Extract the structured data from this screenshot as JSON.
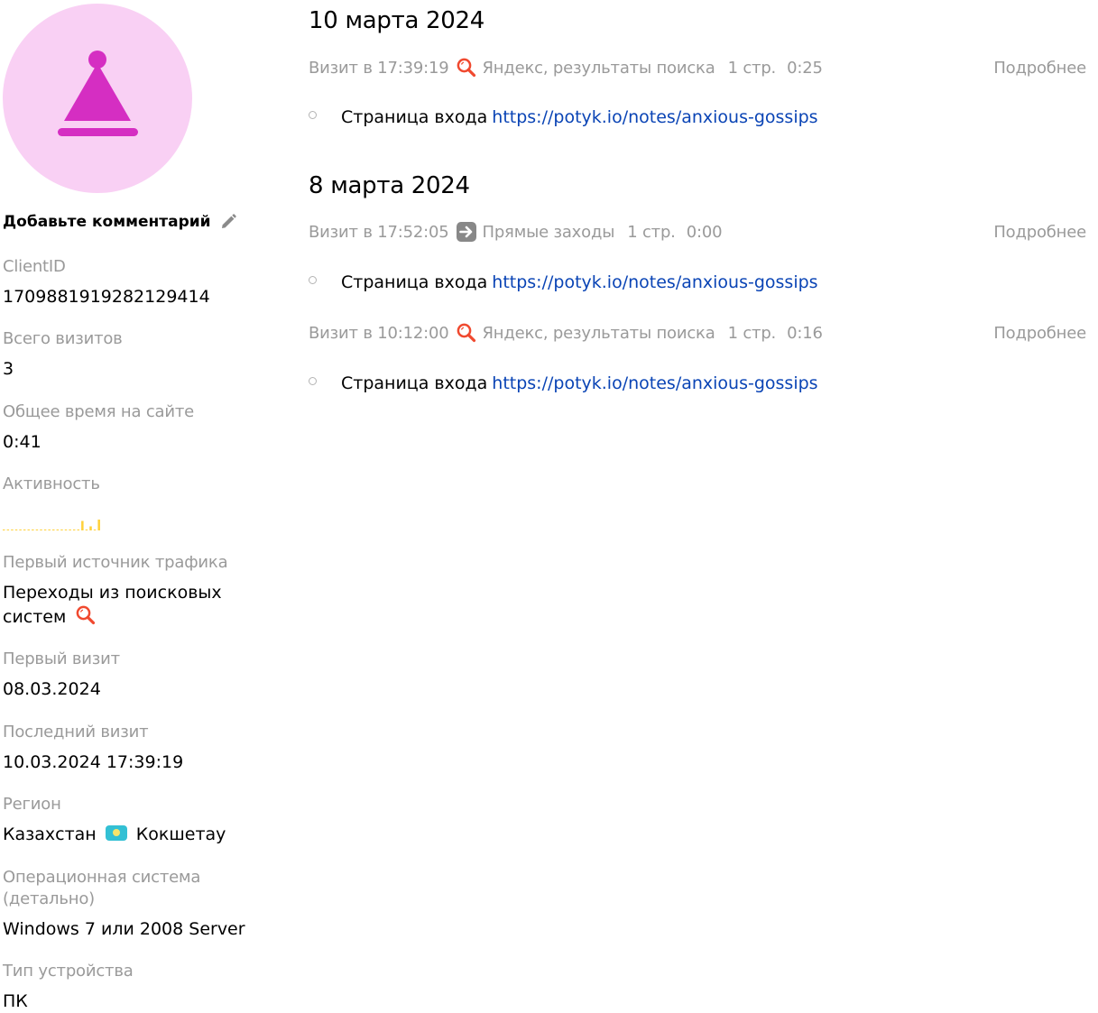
{
  "sidebar": {
    "comment_placeholder": "Добавьте комментарий",
    "fields": [
      {
        "label": "ClientID",
        "value": "1709881919282129414"
      },
      {
        "label": "Всего визитов",
        "value": "3"
      },
      {
        "label": "Общее время на сайте",
        "value": "0:41"
      },
      {
        "label": "Активность"
      },
      {
        "label": "Первый источник трафика",
        "value": "Переходы из поисковых",
        "value_line2": "систем"
      },
      {
        "label": "Первый визит",
        "value": "08.03.2024"
      },
      {
        "label": "Последний визит",
        "value": "10.03.2024 17:39:19"
      },
      {
        "label": "Регион",
        "country": "Казахстан",
        "city": "Кокшетау"
      },
      {
        "label": "Операционная система",
        "label_line2": "(детально)",
        "value": "Windows 7 или 2008 Server"
      },
      {
        "label": "Тип устройства",
        "value": "ПК"
      }
    ],
    "activity_levels": [
      0,
      0,
      0,
      0,
      0,
      0,
      0,
      0,
      0,
      0,
      0,
      0,
      0,
      0,
      0,
      0,
      0,
      0,
      0,
      0.35,
      0,
      0.15,
      0,
      0.4
    ],
    "icons": {
      "avatar": "party-hat-icon",
      "edit": "pencil-icon",
      "first_source": "search-icon",
      "region": "kazakhstan-flag-icon"
    },
    "colors": {
      "avatar_bg": "#f9d0f4",
      "avatar_fg": "#d52ec2",
      "activity": "#ffd13a"
    }
  },
  "main": {
    "days": [
      {
        "date": "10 марта 2024",
        "visits": [
          {
            "time": "Визит в 17:39:19",
            "source": "Яндекс, результаты поиска",
            "source_icon": "search-icon",
            "pages": "1 стр.",
            "duration": "0:25",
            "details": "Подробнее",
            "entry_label": "Страница входа",
            "entry_url": "https://potyk.io/notes/anxious-gossips"
          }
        ]
      },
      {
        "date": "8 марта 2024",
        "visits": [
          {
            "time": "Визит в 17:52:05",
            "source": "Прямые заходы",
            "source_icon": "direct-arrow-icon",
            "pages": "1 стр.",
            "duration": "0:00",
            "details": "Подробнее",
            "entry_label": "Страница входа",
            "entry_url": "https://potyk.io/notes/anxious-gossips"
          },
          {
            "time": "Визит в 10:12:00",
            "source": "Яндекс, результаты поиска",
            "source_icon": "search-icon",
            "pages": "1 стр.",
            "duration": "0:16",
            "details": "Подробнее",
            "entry_label": "Страница входа",
            "entry_url": "https://potyk.io/notes/anxious-gossips"
          }
        ]
      }
    ],
    "colors": {
      "link": "#0a44b5",
      "search_icon": "#f0492f",
      "direct_icon": "#888888"
    }
  }
}
